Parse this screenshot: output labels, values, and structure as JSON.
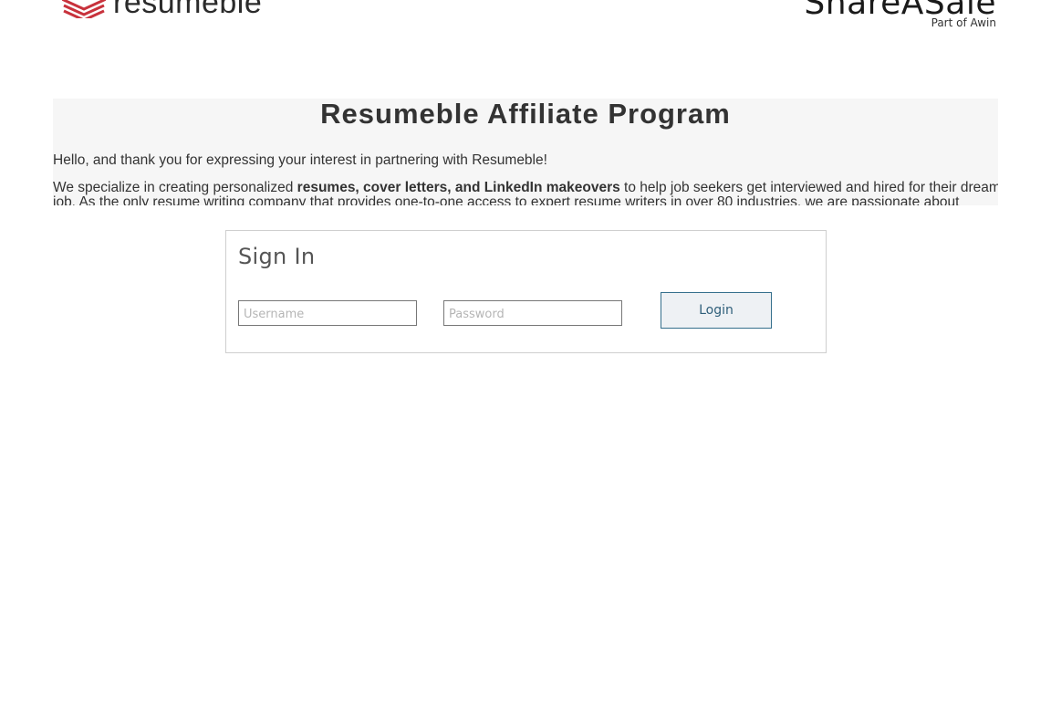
{
  "header": {
    "left_logo_text": "resumeble",
    "right_logo_text": "ShareASale",
    "right_logo_subtext": "Part of Awin"
  },
  "intro": {
    "title": "Resumeble Affiliate Program",
    "greeting": "Hello, and thank you for expressing your interest in partnering with Resumeble!",
    "body_lead": "We specialize in creating personalized ",
    "body_bold": "resumes, cover letters, and LinkedIn makeovers",
    "body_rest": " to help job seekers get interviewed and hired for their dream job. As the only resume writing company that provides one-to-one access to expert resume writers in over 80 industries, we are passionate about helping professionals"
  },
  "signin": {
    "title": "Sign In",
    "username_placeholder": "Username",
    "password_placeholder": "Password",
    "login_label": "Login"
  },
  "colors": {
    "brand_red": "#c8323c",
    "button_border": "#356f8c"
  }
}
